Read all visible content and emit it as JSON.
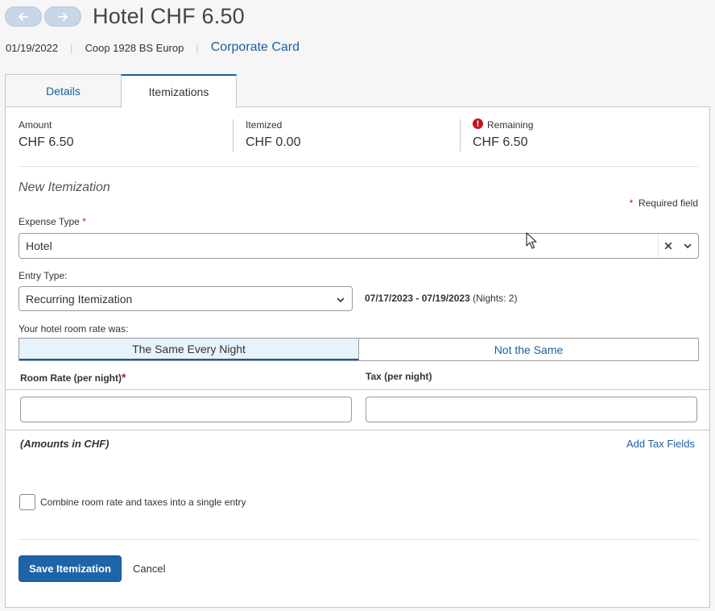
{
  "header": {
    "title": "Hotel CHF 6.50",
    "date": "01/19/2022",
    "vendor": "Coop 1928 BS Europ",
    "payment_type": "Corporate Card"
  },
  "tabs": [
    {
      "label": "Details",
      "active": false
    },
    {
      "label": "Itemizations",
      "active": true
    }
  ],
  "summary": {
    "amount_label": "Amount",
    "amount_value": "CHF 6.50",
    "itemized_label": "Itemized",
    "itemized_value": "CHF 0.00",
    "remaining_label": "Remaining",
    "remaining_value": "CHF 6.50"
  },
  "form": {
    "section_title": "New Itemization",
    "required_note": "Required field",
    "required_star": "*",
    "expense_type_label": "Expense Type",
    "expense_type_value": "Hotel",
    "entry_type_label": "Entry Type:",
    "entry_type_value": "Recurring Itemization",
    "date_range": "07/17/2023 - 07/19/2023",
    "nights": "(Nights: 2)",
    "room_rate_question": "Your hotel room rate was:",
    "toggle_same": "The Same Every Night",
    "toggle_not_same": "Not the Same",
    "room_rate_label": "Room Rate (per night)",
    "tax_label": "Tax (per night)",
    "room_rate_value": "",
    "tax_value": "",
    "amounts_note": "(Amounts in CHF)",
    "add_tax_fields": "Add Tax Fields",
    "combine_label": "Combine room rate and taxes into a single entry",
    "save_label": "Save Itemization",
    "cancel_label": "Cancel"
  },
  "colors": {
    "accent": "#1b5f9e",
    "error": "#c0171d",
    "toggle_active_bg": "#e6f3fb"
  }
}
